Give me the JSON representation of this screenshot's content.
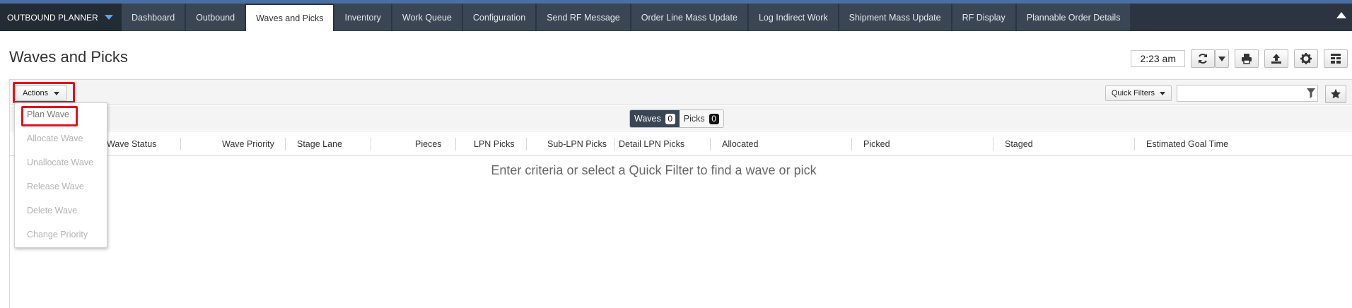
{
  "nav": {
    "app_title": "OUTBOUND PLANNER",
    "tabs": [
      {
        "label": "Dashboard"
      },
      {
        "label": "Outbound"
      },
      {
        "label": "Waves and Picks"
      },
      {
        "label": "Inventory"
      },
      {
        "label": "Work Queue"
      },
      {
        "label": "Configuration"
      },
      {
        "label": "Send RF Message"
      },
      {
        "label": "Order Line Mass Update"
      },
      {
        "label": "Log Indirect Work"
      },
      {
        "label": "Shipment Mass Update"
      },
      {
        "label": "RF Display"
      },
      {
        "label": "Plannable Order Details"
      }
    ],
    "active_tab": "Waves and Picks"
  },
  "header": {
    "title": "Waves and Picks",
    "time": "2:23 am",
    "icons": [
      "refresh-icon",
      "chevron-down-icon",
      "print-icon",
      "upload-icon",
      "gear-icon",
      "layout-icon"
    ]
  },
  "toolbar": {
    "actions_label": "Actions",
    "quick_filters_label": "Quick Filters",
    "filter_value": "",
    "toggle": [
      {
        "label": "Waves",
        "count": "0"
      },
      {
        "label": "Picks",
        "count": "0"
      }
    ]
  },
  "actions_menu": [
    {
      "label": "Plan Wave",
      "enabled": true
    },
    {
      "label": "Allocate Wave",
      "enabled": false
    },
    {
      "label": "Unallocate Wave",
      "enabled": false
    },
    {
      "label": "Release Wave",
      "enabled": false
    },
    {
      "label": "Delete Wave",
      "enabled": false
    },
    {
      "label": "Change Priority",
      "enabled": false
    }
  ],
  "grid": {
    "columns": [
      "Wave Status",
      "Wave Priority",
      "Stage Lane",
      "Pieces",
      "LPN Picks",
      "Sub-LPN Picks",
      "Detail LPN Picks",
      "Allocated",
      "Picked",
      "Staged",
      "Estimated Goal Time"
    ],
    "empty_message": "Enter criteria or select a Quick Filter to find a wave or pick"
  },
  "colors": {
    "nav_bg": "#2b3440",
    "tab_bg": "#3a4654",
    "accent": "#4a6fa5",
    "highlight_box": "#e0131c"
  }
}
